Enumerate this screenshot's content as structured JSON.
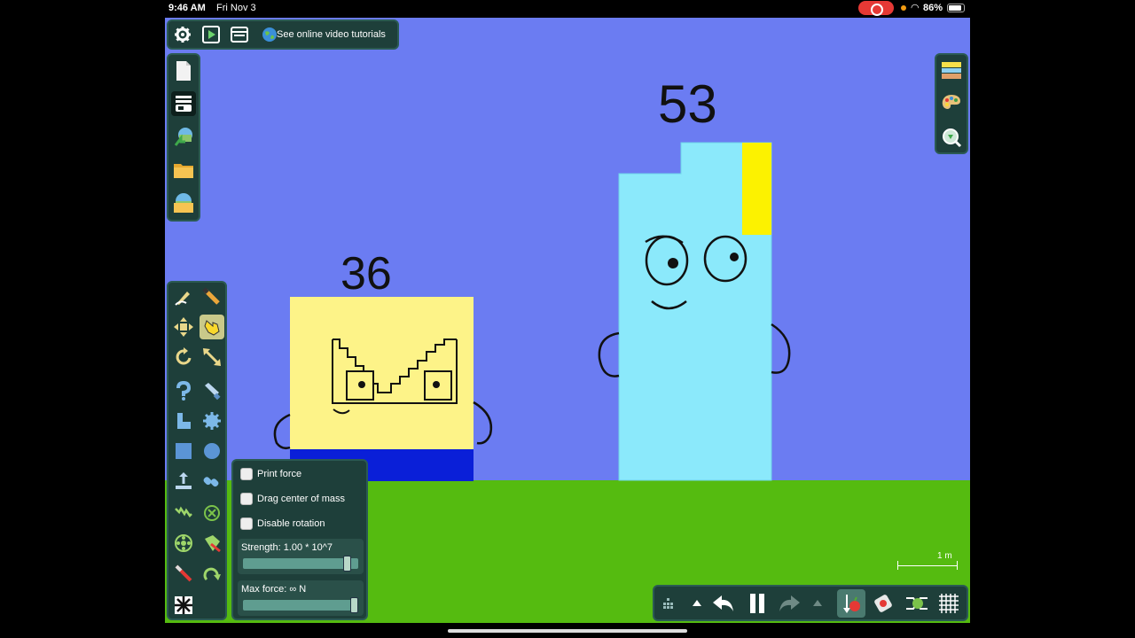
{
  "status_bar": {
    "time": "9:46 AM",
    "date": "Fri Nov 3",
    "battery": "86%"
  },
  "top_toolbar": {
    "buttons": [
      "settings-icon",
      "play-scene-icon",
      "window-icon"
    ],
    "tutorials_label": "See online video tutorials"
  },
  "file_toolbar": {
    "buttons": [
      "new-file-icon",
      "scene-icon",
      "export-icon",
      "open-folder-icon",
      "open-scene-icon"
    ]
  },
  "right_toolbar": {
    "buttons": [
      "background-layers-icon",
      "palette-icon",
      "zoom-icon"
    ]
  },
  "tools_toolbar": {
    "buttons": [
      "sketch-tool-icon",
      "brush-tool-icon",
      "move-tool-icon",
      "drag-tool-icon",
      "rotate-tool-icon",
      "scale-tool-icon",
      "rope-tool-icon",
      "knife-tool-icon",
      "polygon-tool-icon",
      "gear-tool-icon",
      "box-tool-icon",
      "circle-tool-icon",
      "plane-tool-icon",
      "chain-tool-icon",
      "spring-tool-icon",
      "fixate-tool-icon",
      "axle-tool-icon",
      "tracer-tool-icon",
      "laser-tool-icon",
      "hinge-tool-icon",
      "thruster-tool-icon"
    ],
    "selected": "drag-tool-icon"
  },
  "drag_options": {
    "print_force": "Print force",
    "drag_center_of_mass": "Drag center of mass",
    "disable_rotation": "Disable rotation",
    "strength_label": "Strength:  1.00 * 10^7",
    "strength_value": 0.93,
    "max_force_label": "Max force:  ∞  N",
    "max_force_value": 1.0
  },
  "playback_bar": {
    "buttons": [
      "grid-dots-icon",
      "up-arrow-icon",
      "undo-icon",
      "pause-icon",
      "redo-icon",
      "up-arrow-icon",
      "gravity-icon",
      "air-friction-icon",
      "simulation-icon",
      "grid-icon"
    ]
  },
  "scale_indicator": "1 m",
  "scene": {
    "character_left_label": "36",
    "character_right_label": "53",
    "colors": {
      "sky": "#6b7cf2",
      "ground": "#55bb10",
      "left_body": "#fdf388",
      "left_base": "#0a1fd8",
      "right_body": "#8be9fb",
      "right_accent": "#fcf200",
      "panel": "#1e3f3a"
    }
  }
}
